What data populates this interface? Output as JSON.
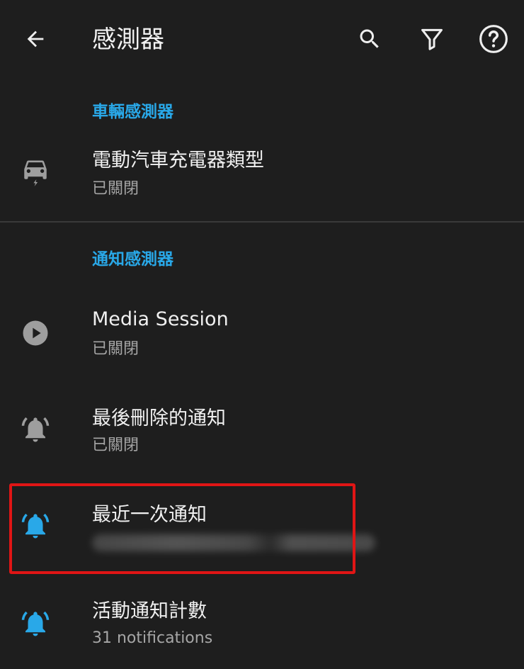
{
  "app_bar": {
    "title": "感測器",
    "back_icon": "arrow-back-icon",
    "search_icon": "search-icon",
    "filter_icon": "filter-icon",
    "help_icon": "help-circle-icon"
  },
  "sections": [
    {
      "header": "車輛感測器",
      "items": [
        {
          "icon": "car-electric-icon",
          "title": "電動汽車充電器類型",
          "summary": "已關閉"
        }
      ]
    },
    {
      "header": "通知感測器",
      "items": [
        {
          "icon": "play-circle-icon",
          "title": "Media Session",
          "summary": "已關閉"
        },
        {
          "icon": "bell-ring-icon",
          "title": "最後刪除的通知",
          "summary": "已關閉"
        },
        {
          "icon": "bell-ring-icon",
          "title": "最近一次通知",
          "summary": ""
        },
        {
          "icon": "bell-ring-icon",
          "title": "活動通知計數",
          "summary": "31 notifications"
        }
      ]
    }
  ],
  "colors": {
    "background": "#1e1e1e",
    "accent": "#29a8e8",
    "icon_inactive": "#9e9e9e",
    "highlight": "#e01515"
  }
}
